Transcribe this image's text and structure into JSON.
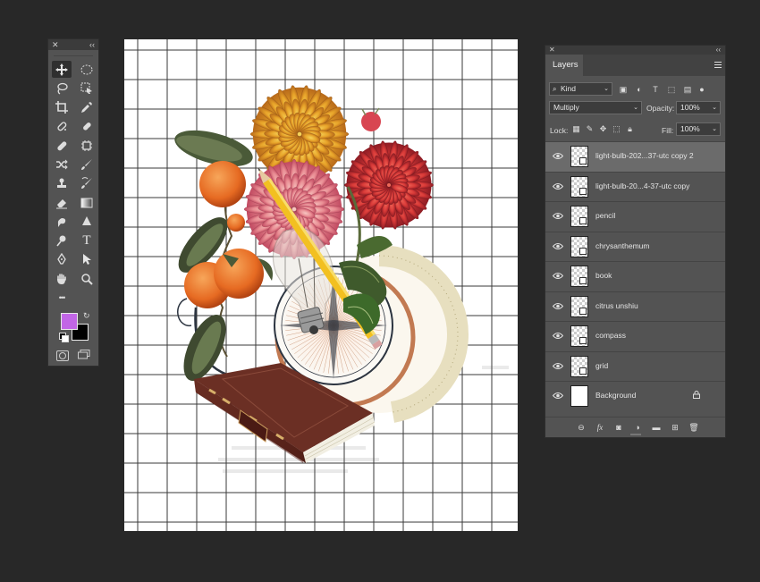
{
  "tools_panel": {
    "close_icon": "close-icon",
    "collapse_icon": "collapse-icon",
    "tools": [
      {
        "name": "move-tool",
        "icon": "move"
      },
      {
        "name": "elliptical-marquee-tool",
        "icon": "ellipse"
      },
      {
        "name": "lasso-tool",
        "icon": "lasso"
      },
      {
        "name": "object-selection-tool",
        "icon": "object-select"
      },
      {
        "name": "crop-tool",
        "icon": "crop"
      },
      {
        "name": "eyedropper-tool",
        "icon": "eyedropper"
      },
      {
        "name": "spot-healing-brush-tool",
        "icon": "healing"
      },
      {
        "name": "content-aware-move-tool",
        "icon": "patch"
      },
      {
        "name": "healing-brush-tool",
        "icon": "bandage"
      },
      {
        "name": "frame-tool",
        "icon": "frame"
      },
      {
        "name": "shuffle-tool",
        "icon": "shuffle"
      },
      {
        "name": "brush-tool",
        "icon": "brush"
      },
      {
        "name": "clone-stamp-tool",
        "icon": "stamp"
      },
      {
        "name": "history-brush-tool",
        "icon": "history-brush"
      },
      {
        "name": "eraser-tool",
        "icon": "eraser"
      },
      {
        "name": "gradient-tool",
        "icon": "gradient"
      },
      {
        "name": "smudge-tool",
        "icon": "smudge"
      },
      {
        "name": "blur-tool",
        "icon": "blur"
      },
      {
        "name": "dodge-tool",
        "icon": "dodge"
      },
      {
        "name": "type-tool",
        "icon": "type"
      },
      {
        "name": "pen-tool",
        "icon": "pen"
      },
      {
        "name": "path-selection-tool",
        "icon": "arrow"
      },
      {
        "name": "hand-tool",
        "icon": "hand"
      },
      {
        "name": "zoom-tool",
        "icon": "zoom"
      },
      {
        "name": "edit-toolbar",
        "icon": "more"
      }
    ],
    "type_glyph": "T",
    "more_glyph": "•••",
    "foreground_color": "#c266e6",
    "background_color": "#000000"
  },
  "layers_panel": {
    "tab_label": "Layers",
    "filter_kind": "Kind",
    "blend_mode": "Multiply",
    "opacity_label": "Opacity:",
    "opacity_value": "100%",
    "lock_label": "Lock:",
    "fill_label": "Fill:",
    "fill_value": "100%",
    "layers": [
      {
        "name": "light-bulb-202...37-utc copy 2",
        "selected": true,
        "visible": true,
        "thumb": "transparent"
      },
      {
        "name": "light-bulb-20...4-37-utc copy",
        "selected": false,
        "visible": true,
        "thumb": "transparent"
      },
      {
        "name": "pencil",
        "selected": false,
        "visible": true,
        "thumb": "transparent"
      },
      {
        "name": "chrysanthemum",
        "selected": false,
        "visible": true,
        "thumb": "transparent"
      },
      {
        "name": "book",
        "selected": false,
        "visible": true,
        "thumb": "transparent"
      },
      {
        "name": "citrus unshiu",
        "selected": false,
        "visible": true,
        "thumb": "transparent"
      },
      {
        "name": "compass",
        "selected": false,
        "visible": true,
        "thumb": "transparent"
      },
      {
        "name": "grid",
        "selected": false,
        "visible": true,
        "thumb": "transparent"
      },
      {
        "name": "Background",
        "selected": false,
        "visible": true,
        "thumb": "white",
        "locked": true
      }
    ],
    "footer_icons": [
      "link-icon",
      "fx-icon",
      "mask-icon",
      "adjustment-icon",
      "folder-icon",
      "new-layer-icon",
      "trash-icon"
    ],
    "fx_label": "fx"
  },
  "canvas": {
    "grid_color": "#3a3a3a",
    "book_color": "#6b2f24",
    "pencil_color": "#f2c021"
  }
}
